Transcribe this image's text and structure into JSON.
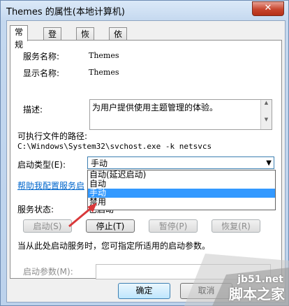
{
  "window": {
    "title": "Themes 的属性(本地计算机)",
    "close_glyph": "✕"
  },
  "tabs": [
    {
      "label": "常规"
    },
    {
      "label": "登录"
    },
    {
      "label": "恢复"
    },
    {
      "label": "依存关系"
    }
  ],
  "general": {
    "service_name_label": "服务名称:",
    "service_name_value": "Themes",
    "display_name_label": "显示名称:",
    "display_name_value": "Themes",
    "description_label": "描述:",
    "description_value": "为用户提供使用主题管理的体验。",
    "path_label": "可执行文件的路径:",
    "path_value": "C:\\Windows\\System32\\svchost.exe -k netsvcs",
    "startup_type_label": "启动类型(E):",
    "startup_type_value": "手动",
    "startup_options": [
      "自动(延迟启动)",
      "自动",
      "手动",
      "禁用"
    ],
    "startup_selected_index": 2,
    "help_link": "帮助我配置服务启",
    "status_label": "服务状态:",
    "status_value": "已启动",
    "start_button": "启动(S)",
    "stop_button": "停止(T)",
    "pause_button": "暂停(P)",
    "resume_button": "恢复(R)",
    "hint_text": "当从此处启动服务时，您可指定所适用的启动参数。",
    "params_label": "启动参数(M):"
  },
  "footer": {
    "ok_button": "确定",
    "cancel_button": "取消"
  },
  "watermark": {
    "line1": "jb51.net",
    "line2": "脚本之家"
  },
  "colors": {
    "selection": "#3399ff",
    "link": "#0066cc",
    "arrow": "#d9383a"
  }
}
